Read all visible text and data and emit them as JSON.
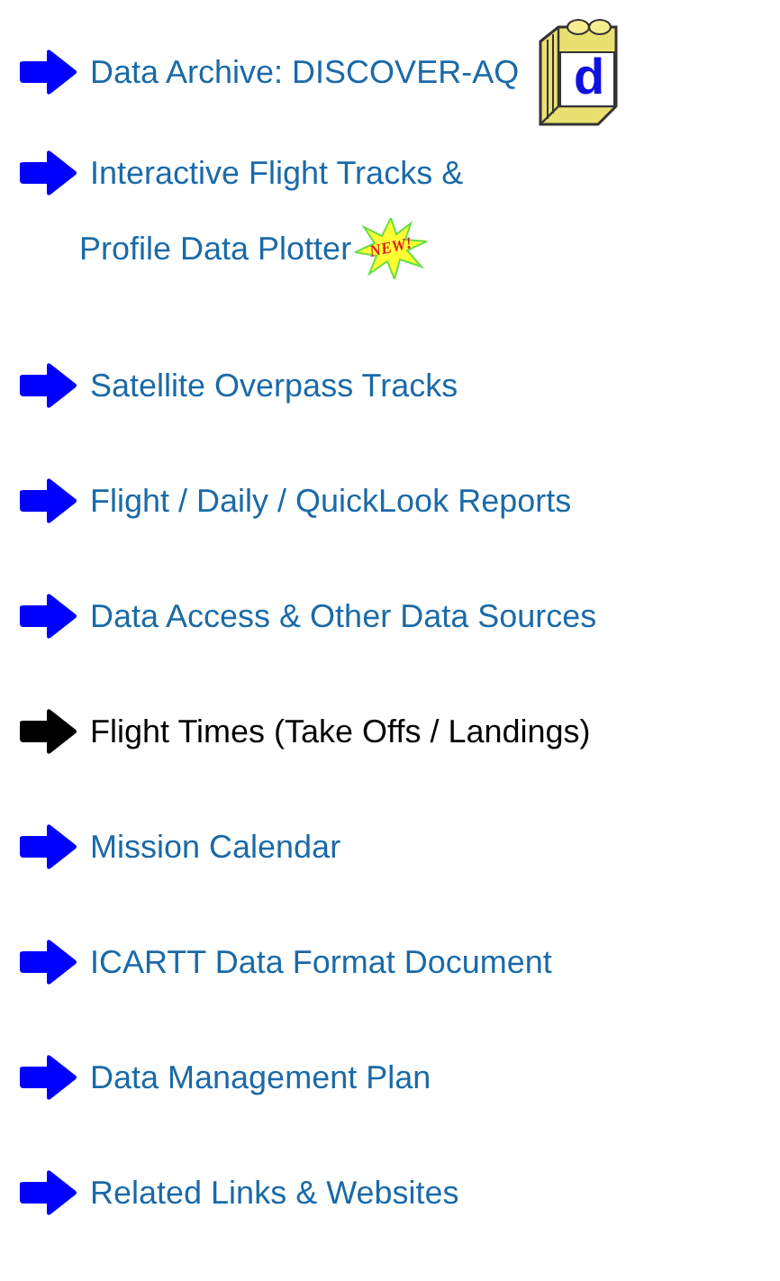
{
  "links": [
    {
      "text": "Data Archive: DISCOVER-AQ",
      "selected": false,
      "icon": {
        "kind": "folder",
        "letter": "d"
      }
    },
    {
      "text": "Interactive Flight Tracks &",
      "text_line_2": "Profile Data Plotter",
      "selected": false,
      "badge": "NEW!"
    },
    {
      "text": "Satellite Overpass Tracks",
      "selected": false
    },
    {
      "text": "Flight / Daily / QuickLook Reports",
      "selected": false
    },
    {
      "text": "Data Access & Other Data Sources",
      "selected": false
    },
    {
      "text": "Flight Times (Take Offs / Landings)",
      "selected": true
    },
    {
      "text": "Mission Calendar",
      "selected": false
    },
    {
      "text": "ICARTT Data Format Document",
      "selected": false
    },
    {
      "text": "Data Management Plan",
      "selected": false
    },
    {
      "text": "Related Links & Websites",
      "selected": false
    }
  ]
}
